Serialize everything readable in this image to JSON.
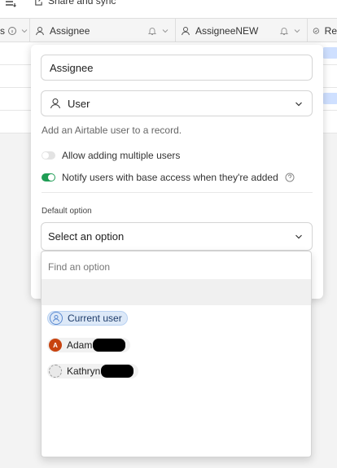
{
  "topbar": {
    "share_label": "Share and sync"
  },
  "header": {
    "columns": [
      {
        "label": "s"
      },
      {
        "label": "Assignee"
      },
      {
        "label": "AssigneeNEW"
      },
      {
        "label": "Re"
      }
    ]
  },
  "field_editor": {
    "name_value": "Assignee",
    "type_label": "User",
    "description": "Add an Airtable user to a record.",
    "toggle_multiple": {
      "label": "Allow adding multiple users",
      "on": false
    },
    "toggle_notify": {
      "label": "Notify users with base access when they're added",
      "on": true
    },
    "default_option_label": "Default option",
    "select_placeholder": "Select an option"
  },
  "dropdown": {
    "search_placeholder": "Find an option",
    "options": [
      {
        "label": "Current user",
        "icon": "current-user-icon"
      },
      {
        "label": "Adam",
        "initial": "A",
        "avatar_color": "#c8430f"
      },
      {
        "label": "Kathryn",
        "icon": "placeholder-avatar-icon"
      }
    ]
  },
  "colors": {
    "accent": "#2d7ff9",
    "toggle_on": "#1f9d55",
    "adam_avatar": "#c8430f"
  }
}
